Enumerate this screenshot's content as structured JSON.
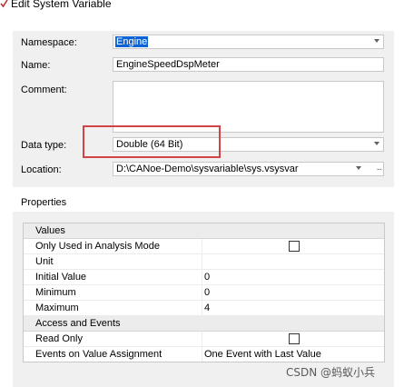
{
  "window": {
    "title": "Edit System Variable"
  },
  "form": {
    "namespace_label": "Namespace:",
    "namespace_value": "Engine",
    "name_label": "Name:",
    "name_value": "EngineSpeedDspMeter",
    "comment_label": "Comment:",
    "comment_value": "",
    "datatype_label": "Data type:",
    "datatype_value": "Double (64 Bit)",
    "location_label": "Location:",
    "location_value": "D:\\CANoe-Demo\\sysvariable\\sys.vsysvar",
    "location_more": "..."
  },
  "properties": {
    "title": "Properties",
    "sections": [
      {
        "header": "Values",
        "rows": [
          {
            "key": "Only Used in Analysis Mode",
            "value": "",
            "checkbox": true,
            "checked": false
          },
          {
            "key": "Unit",
            "value": ""
          },
          {
            "key": "Initial Value",
            "value": "0"
          },
          {
            "key": "Minimum",
            "value": "0"
          },
          {
            "key": "Maximum",
            "value": "4"
          }
        ]
      },
      {
        "header": "Access and Events",
        "rows": [
          {
            "key": "Read Only",
            "value": "",
            "checkbox": true,
            "checked": false
          },
          {
            "key": "Events on Value Assignment",
            "value": "One Event with Last Value"
          }
        ]
      }
    ]
  },
  "watermark": "CSDN @蚂蚁小兵",
  "colors": {
    "highlight": "#0a64d6",
    "annotation": "#d24444",
    "panel": "#f0f0f0"
  }
}
